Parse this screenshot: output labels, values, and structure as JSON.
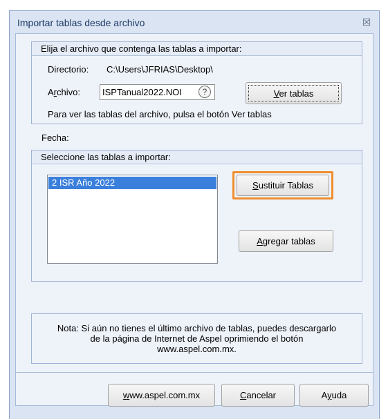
{
  "window": {
    "title": "Importar tablas desde archivo",
    "close_glyph": "☒"
  },
  "file_group": {
    "header": "Elija el archivo que contenga las tablas a importar:",
    "directorio_label": "Directorio:",
    "directorio_value": "C:\\Users\\JFRIAS\\Desktop\\",
    "archivo_label_pre": "A",
    "archivo_label_ul": "r",
    "archivo_label_post": "chivo:",
    "archivo_value": "ISPTanual2022.NOI",
    "help_glyph": "?",
    "ver_tablas_ul": "V",
    "ver_tablas_rest": "er tablas",
    "hint": "Para ver las tablas del archivo, pulsa el botón Ver tablas"
  },
  "fecha_label": "Fecha:",
  "tables_group": {
    "header": "Seleccione las tablas a importar:",
    "items": [
      {
        "label": "2 ISR Año 2022",
        "selected": true
      }
    ],
    "sustituir_ul": "S",
    "sustituir_rest": "ustituir Tablas",
    "agregar_ul": "A",
    "agregar_rest": "gregar tablas"
  },
  "nota": {
    "line1": "Nota: Si aún no tienes el último archivo de tablas, puedes descargarlo",
    "line2": "de la página de Internet de Aspel oprimiendo el botón",
    "line3": "www.aspel.com.mx."
  },
  "buttons": {
    "aspel_ul": "w",
    "aspel_rest": "ww.aspel.com.mx",
    "cancelar_ul": "C",
    "cancelar_rest": "ancelar",
    "ayuda_pre": "A",
    "ayuda_ul": "y",
    "ayuda_post": "uda"
  },
  "colors": {
    "highlight": "#f08d2c",
    "selection": "#3b7fdc",
    "window_bg": "#dae4f3"
  }
}
